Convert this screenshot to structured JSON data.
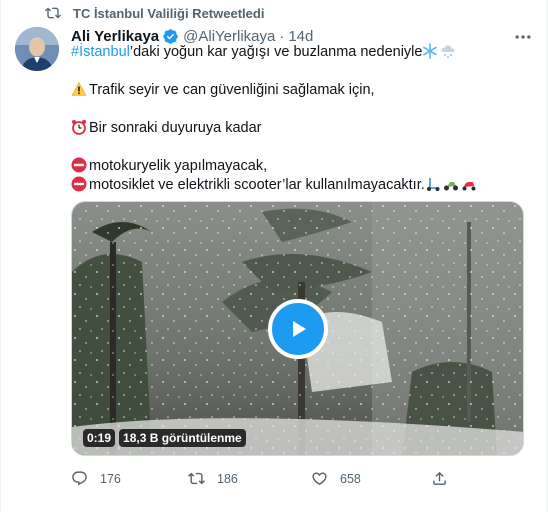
{
  "retweet_label": "TC İstanbul Valiliği Retweetledi",
  "author": {
    "name": "Ali Yerlikaya",
    "handle": "@AliYerlikaya",
    "separator": "·",
    "time": "14d"
  },
  "tweet": {
    "hashtag": "#İstanbul",
    "line1_rest": "’daki yoğun kar yağışı ve buzlanma nedeniyle",
    "line2": "Trafik seyir ve can güvenliğini sağlamak için,",
    "line3": "Bir sonraki duyuruya kadar",
    "line4": "motokuryelik yapılmayacak,",
    "line5": "motosiklet ve elektrikli scooter’lar kullanılmayacaktır."
  },
  "video": {
    "duration": "0:19",
    "views": "18,3 B görüntülenme"
  },
  "actions": {
    "replies": "176",
    "retweets": "186",
    "likes": "658"
  },
  "icons": {
    "retweet": "retweet-icon",
    "verified": "verified-badge-icon",
    "more": "more-options-icon",
    "warning": "warning-emoji-icon",
    "alarm": "alarm-clock-emoji-icon",
    "no_entry": "no-entry-emoji-icon",
    "snowflake": "snowflake-emoji-icon",
    "cloud_snow": "cloud-snow-emoji-icon",
    "scooter": "scooter-emoji-icon",
    "motorcycle": "motorcycle-emoji-icon",
    "play": "play-icon",
    "reply": "reply-icon",
    "like": "heart-icon",
    "share": "share-icon"
  },
  "colors": {
    "accent": "#1d9bf0",
    "text": "#0f1419",
    "secondary": "#536471"
  }
}
